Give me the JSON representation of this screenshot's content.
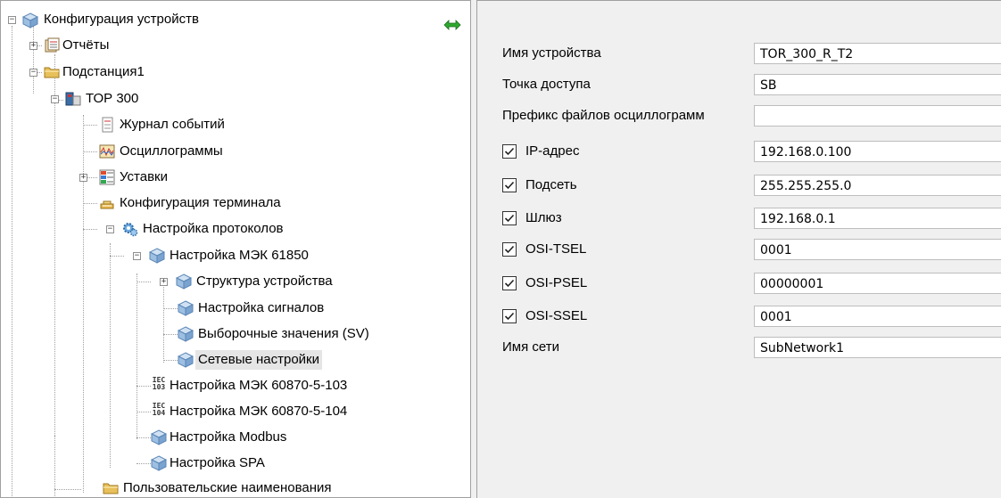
{
  "tree": {
    "root": "Конфигурация устройств",
    "reports": "Отчёты",
    "substation": "Подстанция1",
    "device": "ТОР 300",
    "event_log": "Журнал событий",
    "oscillograms": "Осциллограммы",
    "settings": "Уставки",
    "terminal_config": "Конфигурация терминала",
    "protocol_setup": "Настройка протоколов",
    "iec61850": "Настройка МЭК 61850",
    "device_structure": "Структура устройства",
    "signal_setup": "Настройка сигналов",
    "sampled_values": "Выборочные значения (SV)",
    "network_settings": "Сетевые настройки",
    "iec103": "Настройка МЭК 60870-5-103",
    "iec104": "Настройка МЭК 60870-5-104",
    "modbus": "Настройка Modbus",
    "spa": "Настройка SPA",
    "user_names": "Пользовательские наименования",
    "iec_icon_top": "IEC",
    "iec_icon_103": "103",
    "iec_icon_104": "104",
    "selected_item": "network_settings"
  },
  "properties": {
    "rows": [
      {
        "label": "Имя устройства",
        "value": "TOR_300_R_T2",
        "checkbox": false
      },
      {
        "label": "Точка доступа",
        "value": "SB",
        "checkbox": false
      },
      {
        "label": "Префикс файлов осциллограмм",
        "value": "",
        "checkbox": false
      },
      {
        "label": "IP-адрес",
        "value": "192.168.0.100",
        "checkbox": true,
        "checked": true
      },
      {
        "label": "Подсеть",
        "value": "255.255.255.0",
        "checkbox": true,
        "checked": true
      },
      {
        "label": "Шлюз",
        "value": "192.168.0.1",
        "checkbox": true,
        "checked": true
      },
      {
        "label": "OSI-TSEL",
        "value": "0001",
        "checkbox": true,
        "checked": true
      },
      {
        "label": "OSI-PSEL",
        "value": "00000001",
        "checkbox": true,
        "checked": true
      },
      {
        "label": "OSI-SSEL",
        "value": "0001",
        "checkbox": true,
        "checked": true
      },
      {
        "label": "Имя сети",
        "value": "SubNetwork1",
        "checkbox": false
      }
    ]
  },
  "colors": {
    "selection": "#e5e5e5",
    "panel_bg": "#f0f0f0",
    "folder": "#e8c05a",
    "sync_icon": "#2fa82f"
  }
}
